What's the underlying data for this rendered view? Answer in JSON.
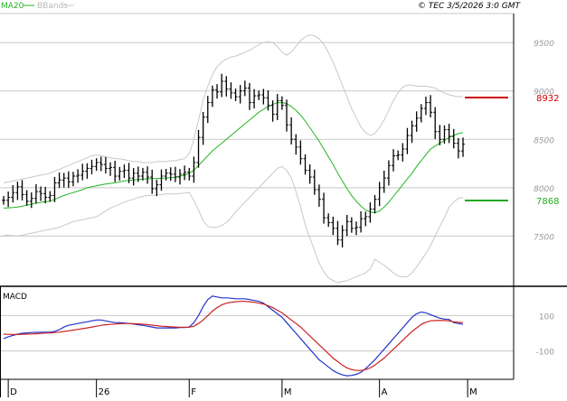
{
  "header": {
    "indicator_ma": "MA20",
    "indicator_bb": "BBands",
    "info": "© TEC 3/5/2026 3:0 GMT"
  },
  "colors": {
    "price_bar": "#000000",
    "ma": "#22b522",
    "bbands": "#c8c8c8",
    "resistance": "#cc0000",
    "support": "#22aa22",
    "macd": "#2233cc",
    "signal": "#cc2222",
    "grid": "#c8c8c8",
    "axis": "#000000"
  },
  "chart_data": [
    {
      "type": "ohlc",
      "name": "price",
      "y_ticks": [
        7500,
        8000,
        8500,
        9000,
        9500
      ],
      "ylim": [
        7000,
        9800
      ],
      "x_labels": [
        {
          "label": "D",
          "i": 1
        },
        {
          "label": "26",
          "i": 20
        },
        {
          "label": "F",
          "i": 40
        },
        {
          "label": "M",
          "i": 60
        },
        {
          "label": "A",
          "i": 81
        },
        {
          "label": "M",
          "i": 100
        }
      ],
      "close": [
        7870,
        7900,
        7950,
        8010,
        7930,
        7860,
        7890,
        7960,
        7940,
        7900,
        7920,
        8050,
        8080,
        8100,
        8060,
        8120,
        8130,
        8170,
        8200,
        8220,
        8260,
        8240,
        8200,
        8210,
        8120,
        8170,
        8180,
        8100,
        8150,
        8120,
        8160,
        8110,
        7990,
        8030,
        8120,
        8150,
        8140,
        8110,
        8140,
        8160,
        8120,
        8260,
        8520,
        8730,
        8880,
        9010,
        8990,
        9100,
        9020,
        8980,
        8940,
        9000,
        9030,
        8880,
        8950,
        8960,
        8930,
        8850,
        8760,
        8900,
        8850,
        8650,
        8500,
        8420,
        8300,
        8180,
        8110,
        7980,
        7880,
        7690,
        7640,
        7580,
        7460,
        7560,
        7650,
        7580,
        7590,
        7680,
        7700,
        7780,
        7880,
        8000,
        8100,
        8230,
        8330,
        8340,
        8400,
        8540,
        8640,
        8720,
        8820,
        8880,
        8780,
        8580,
        8500,
        8600,
        8530,
        8460,
        8380,
        8450
      ],
      "ma20": [
        7790,
        7792,
        7795,
        7800,
        7808,
        7820,
        7830,
        7840,
        7848,
        7855,
        7860,
        7880,
        7900,
        7920,
        7935,
        7950,
        7965,
        7980,
        8000,
        8010,
        8020,
        8030,
        8038,
        8045,
        8050,
        8062,
        8070,
        8075,
        8080,
        8085,
        8090,
        8092,
        8094,
        8096,
        8098,
        8100,
        8104,
        8110,
        8120,
        8130,
        8150,
        8180,
        8230,
        8280,
        8330,
        8380,
        8420,
        8460,
        8500,
        8540,
        8580,
        8620,
        8660,
        8700,
        8740,
        8780,
        8810,
        8840,
        8860,
        8880,
        8880,
        8870,
        8840,
        8800,
        8750,
        8690,
        8620,
        8550,
        8480,
        8400,
        8320,
        8240,
        8150,
        8070,
        7990,
        7920,
        7860,
        7810,
        7770,
        7750,
        7740,
        7760,
        7800,
        7850,
        7910,
        7970,
        8030,
        8090,
        8150,
        8220,
        8280,
        8340,
        8400,
        8430,
        8460,
        8490,
        8520,
        8540,
        8560,
        8570
      ],
      "bb_upper": [
        8050,
        8060,
        8070,
        8080,
        8090,
        8100,
        8110,
        8120,
        8130,
        8140,
        8150,
        8170,
        8190,
        8210,
        8230,
        8250,
        8270,
        8290,
        8310,
        8330,
        8340,
        8330,
        8320,
        8310,
        8300,
        8300,
        8290,
        8280,
        8270,
        8270,
        8260,
        8260,
        8260,
        8270,
        8270,
        8270,
        8280,
        8280,
        8290,
        8300,
        8350,
        8500,
        8700,
        8900,
        9050,
        9170,
        9250,
        9300,
        9330,
        9350,
        9360,
        9380,
        9400,
        9420,
        9450,
        9480,
        9500,
        9510,
        9500,
        9460,
        9400,
        9370,
        9400,
        9460,
        9520,
        9560,
        9580,
        9570,
        9540,
        9480,
        9400,
        9300,
        9180,
        9060,
        8940,
        8820,
        8720,
        8630,
        8570,
        8540,
        8560,
        8620,
        8700,
        8800,
        8900,
        8980,
        9040,
        9060,
        9060,
        9050,
        9050,
        9050,
        9040,
        9030,
        9000,
        8980,
        8960,
        8950,
        8940,
        8940
      ],
      "bb_lower": [
        7510,
        7510,
        7505,
        7500,
        7510,
        7520,
        7530,
        7540,
        7550,
        7560,
        7570,
        7580,
        7590,
        7610,
        7630,
        7650,
        7660,
        7670,
        7680,
        7690,
        7700,
        7730,
        7760,
        7790,
        7810,
        7830,
        7850,
        7870,
        7880,
        7900,
        7910,
        7920,
        7920,
        7925,
        7930,
        7935,
        7935,
        7935,
        7940,
        7945,
        7950,
        7870,
        7770,
        7660,
        7600,
        7590,
        7590,
        7610,
        7640,
        7690,
        7750,
        7800,
        7850,
        7900,
        7950,
        8000,
        8050,
        8100,
        8150,
        8200,
        8220,
        8180,
        8100,
        7960,
        7800,
        7620,
        7480,
        7350,
        7220,
        7130,
        7070,
        7040,
        7020,
        7030,
        7040,
        7060,
        7080,
        7100,
        7120,
        7160,
        7260,
        7230,
        7200,
        7160,
        7120,
        7090,
        7080,
        7080,
        7120,
        7180,
        7250,
        7320,
        7400,
        7500,
        7600,
        7690,
        7800,
        7850,
        7890,
        7900
      ],
      "levels": [
        {
          "label": "8932",
          "value": 8932,
          "color": "#cc0000"
        },
        {
          "label": "7868",
          "value": 7868,
          "color": "#22aa22"
        }
      ]
    },
    {
      "type": "line",
      "name": "MACD",
      "title": "MACD",
      "y_ticks": [
        {
          "label": "100",
          "value": 100
        },
        {
          "label": "-100",
          "value": -100
        }
      ],
      "ylim": [
        -260,
        260
      ],
      "series": [
        {
          "color": "#2233cc",
          "values": [
            -30,
            -20,
            -12,
            -5,
            0,
            2,
            4,
            5,
            6,
            6,
            6,
            10,
            20,
            35,
            45,
            50,
            55,
            60,
            65,
            70,
            75,
            75,
            70,
            65,
            60,
            60,
            58,
            55,
            52,
            48,
            45,
            40,
            35,
            30,
            30,
            30,
            30,
            30,
            32,
            32,
            35,
            60,
            100,
            150,
            190,
            210,
            205,
            200,
            200,
            198,
            195,
            195,
            195,
            190,
            185,
            180,
            170,
            150,
            130,
            110,
            90,
            60,
            30,
            0,
            -30,
            -60,
            -90,
            -120,
            -150,
            -170,
            -190,
            -210,
            -225,
            -235,
            -240,
            -238,
            -232,
            -220,
            -200,
            -175,
            -150,
            -120,
            -90,
            -60,
            -30,
            0,
            30,
            60,
            90,
            110,
            120,
            115,
            105,
            95,
            85,
            80,
            78,
            60,
            55,
            50
          ]
        },
        {
          "color": "#cc2222",
          "values": [
            -5,
            -6,
            -7,
            -7,
            -6,
            -5,
            -4,
            -3,
            -1,
            1,
            2,
            4,
            6,
            10,
            14,
            18,
            22,
            26,
            30,
            35,
            40,
            45,
            48,
            50,
            52,
            54,
            55,
            55,
            54,
            53,
            51,
            49,
            46,
            43,
            40,
            38,
            36,
            35,
            34,
            34,
            34,
            40,
            55,
            75,
            100,
            125,
            145,
            160,
            170,
            175,
            178,
            180,
            180,
            178,
            175,
            170,
            165,
            155,
            145,
            130,
            115,
            95,
            75,
            55,
            35,
            10,
            -15,
            -40,
            -65,
            -90,
            -115,
            -140,
            -160,
            -180,
            -195,
            -205,
            -210,
            -210,
            -205,
            -195,
            -180,
            -160,
            -140,
            -115,
            -90,
            -65,
            -40,
            -15,
            10,
            30,
            50,
            62,
            70,
            72,
            72,
            72,
            70,
            65,
            62,
            60
          ]
        }
      ]
    }
  ]
}
